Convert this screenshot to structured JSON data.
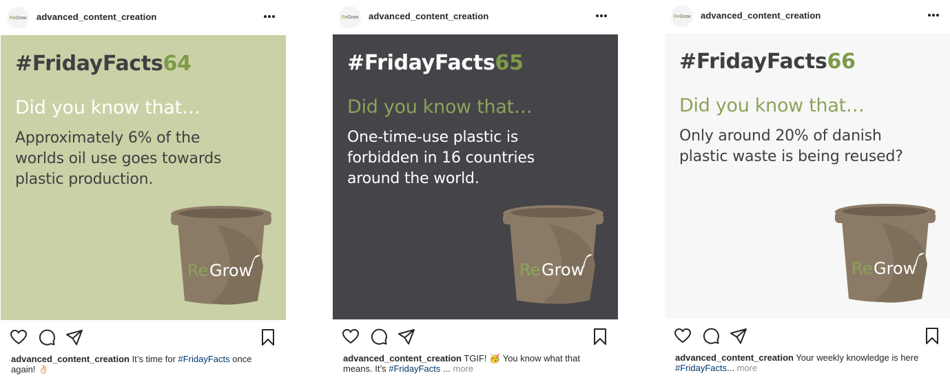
{
  "posts": [
    {
      "username": "advanced_content_creation",
      "avatar": {
        "brand_re": "Re",
        "brand_grow": "Grow"
      },
      "image": {
        "theme": "green",
        "hashtag": "#FridayFacts",
        "number": "64",
        "question": "Did you know that…",
        "fact_lines": [
          "Approximately 6% of the",
          "worlds oil use goes towards",
          "plastic production."
        ],
        "logo_re": "Re",
        "logo_grow": "Grow"
      },
      "caption": {
        "username": "advanced_content_creation",
        "text_before": " It’s time for ",
        "hashtag": "#FridayFacts",
        "text_after": " once again! 👌🏻",
        "more": ""
      }
    },
    {
      "username": "advanced_content_creation",
      "avatar": {
        "brand_re": "Re",
        "brand_grow": "Grow"
      },
      "image": {
        "theme": "dark",
        "hashtag": "#FridayFacts",
        "number": "65",
        "question": "Did you know that…",
        "fact_lines": [
          "One-time-use plastic is",
          "forbidden in 16 countries",
          "around the world."
        ],
        "logo_re": "Re",
        "logo_grow": "Grow"
      },
      "caption": {
        "username": "advanced_content_creation",
        "text_before": " TGIF! 🥳 You know what that means. It’s ",
        "hashtag": "#FridayFacts",
        "text_after": " ... ",
        "more": "more"
      }
    },
    {
      "username": "advanced_content_creation",
      "avatar": {
        "brand_re": "Re",
        "brand_grow": "Grow"
      },
      "image": {
        "theme": "light",
        "hashtag": "#FridayFacts",
        "number": "66",
        "question": "Did you know that…",
        "fact_lines": [
          "Only around 20% of danish",
          "plastic waste is being reused?"
        ],
        "logo_re": "Re",
        "logo_grow": "Grow"
      },
      "caption": {
        "username": "advanced_content_creation",
        "text_before": " Your weekly knowledge is here ",
        "hashtag": "#FridayFacts",
        "text_after": "... ",
        "more": "more"
      }
    }
  ],
  "icons": {
    "more": "more-options-icon",
    "like": "heart-icon",
    "comment": "comment-icon",
    "share": "paper-plane-icon",
    "save": "bookmark-icon"
  },
  "colors": {
    "accent_green": "#7d9a4a",
    "green_bg": "#cbd1a6",
    "dark_bg": "#454449",
    "light_bg": "#f7f7f7",
    "pot": "#8b7b66",
    "hashtag_link": "#00376b"
  }
}
